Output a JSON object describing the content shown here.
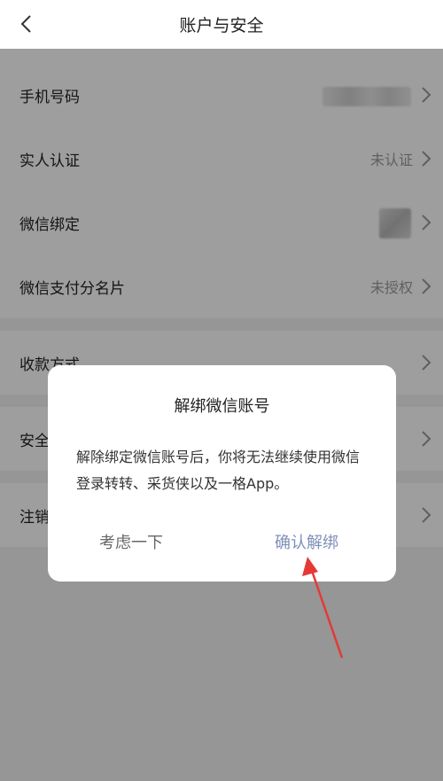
{
  "header": {
    "title": "账户与安全",
    "back_icon": "chevron-left-icon"
  },
  "rows": [
    {
      "label": "手机号码",
      "value": ""
    },
    {
      "label": "实人认证",
      "value": "未认证"
    },
    {
      "label": "微信绑定",
      "value": ""
    },
    {
      "label": "微信支付分名片",
      "value": "未授权"
    },
    {
      "label": "收款方式",
      "value": ""
    },
    {
      "label": "安全",
      "value": ""
    },
    {
      "label": "注销",
      "value": ""
    }
  ],
  "dialog": {
    "title": "解绑微信账号",
    "message": "解除绑定微信账号后，你将无法继续使用微信登录转转、采货侠以及一格App。",
    "cancel_label": "考虑一下",
    "confirm_label": "确认解绑"
  },
  "colors": {
    "annotation_arrow": "#e53935",
    "confirm_text": "#7f8fb8",
    "overlay": "rgba(0,0,0,0.38)"
  }
}
